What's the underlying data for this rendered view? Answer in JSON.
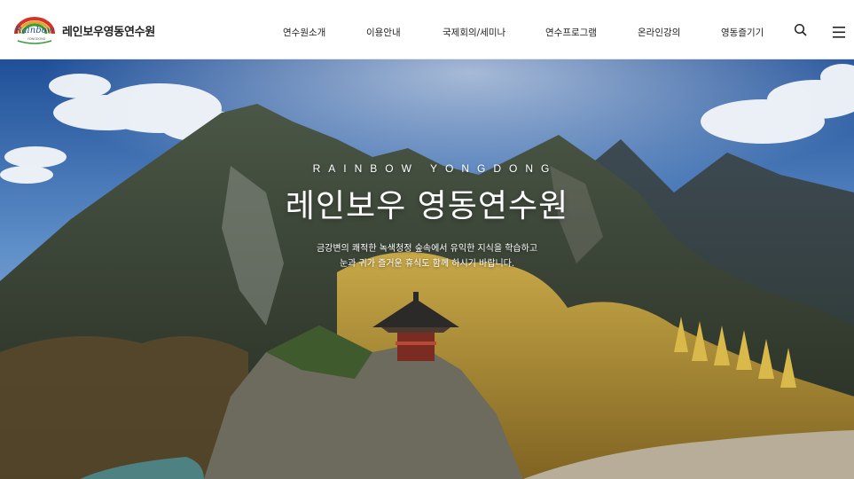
{
  "brand": {
    "logo_word": "Rainbow",
    "logo_sub": "YONGDONG",
    "name": "레인보우영동연수원"
  },
  "nav": {
    "items": [
      "연수원소개",
      "이용안내",
      "국제회의/세미나",
      "연수프로그램",
      "온라인강의",
      "영동즐기기"
    ]
  },
  "header_icons": [
    "search-icon",
    "menu-icon"
  ],
  "hero": {
    "eyebrow": "RAINBOW YONGDONG",
    "title": "레인보우 영동연수원",
    "desc_line1": "금강변의 쾌적한 녹색청정 숲속에서 유익한 지식을 학습하고",
    "desc_line2": "눈과 귀가 즐거운 휴식도 함께 하시기 바랍니다."
  },
  "colors": {
    "sky_top": "#2b5ea8",
    "sky_bottom": "#8fb3d9",
    "mountain_dark": "#2f3a2e",
    "foliage_gold": "#c9a23a"
  }
}
